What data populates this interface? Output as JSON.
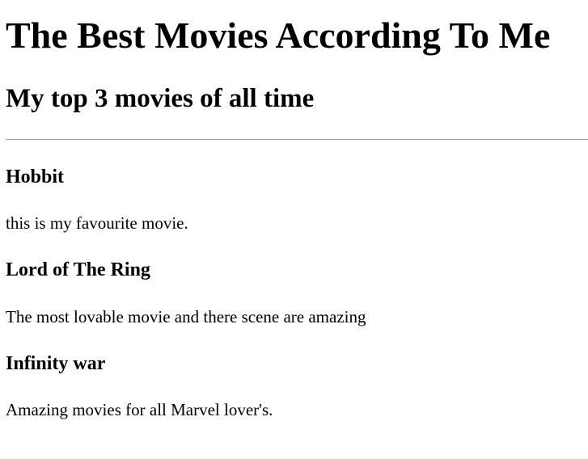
{
  "page": {
    "title": "The Best Movies According To Me",
    "subtitle": "My top 3 movies of all time"
  },
  "movies": [
    {
      "title": "Hobbit",
      "description": "this is my favourite movie."
    },
    {
      "title": "Lord of The Ring",
      "description": "The most lovable movie and there scene are amazing"
    },
    {
      "title": "Infinity war",
      "description": "Amazing movies for all Marvel lover's."
    }
  ]
}
